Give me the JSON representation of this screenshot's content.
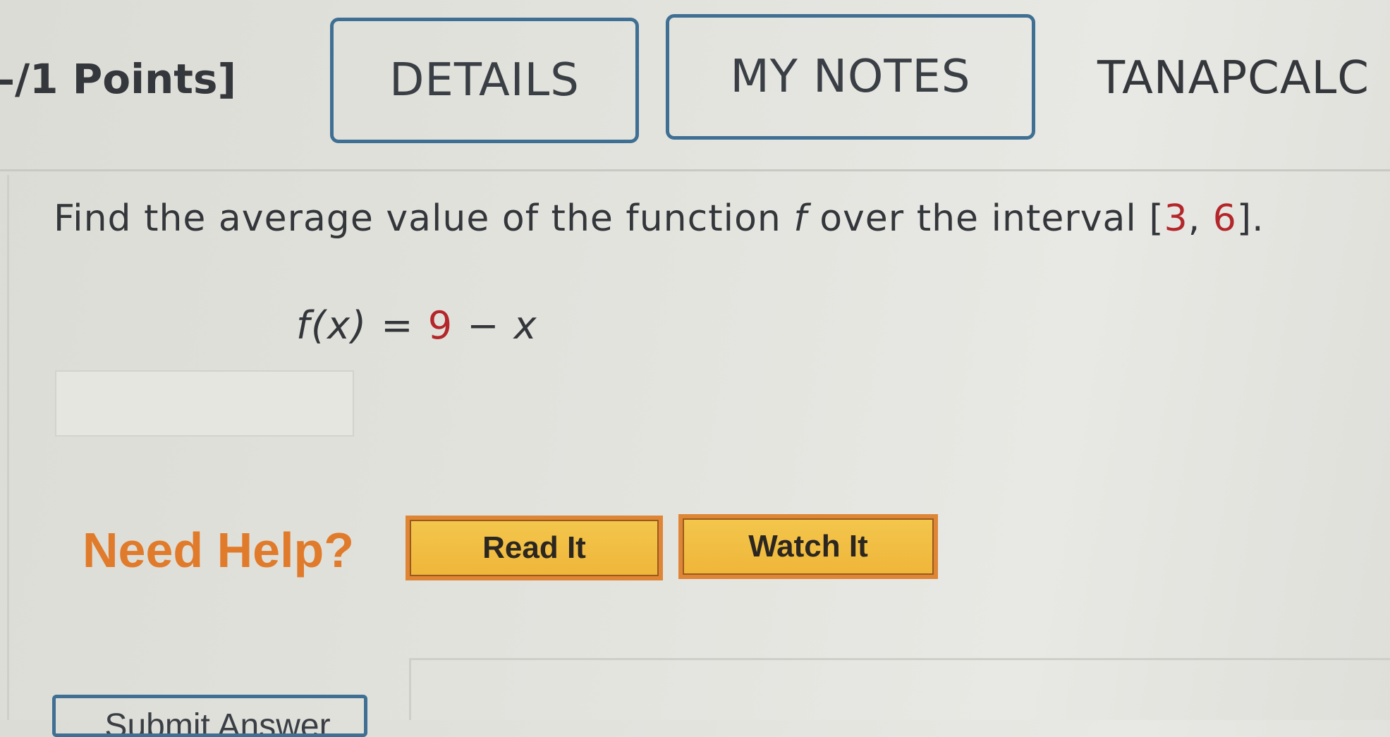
{
  "header": {
    "points_label": "–/1 Points]",
    "details_label": "DETAILS",
    "my_notes_label": "MY NOTES",
    "course_code": "TANAPCALC"
  },
  "question": {
    "prompt_before": "Find the average value of the function ",
    "function_symbol": "f",
    "prompt_middle": " over the interval [",
    "interval_start": "3",
    "interval_sep": ", ",
    "interval_end": "6",
    "prompt_after": "].",
    "equation_lhs": "f(x) = ",
    "equation_const": "9",
    "equation_rest": " − ",
    "equation_var": "x",
    "answer_value": ""
  },
  "help": {
    "need_help_label": "Need Help?",
    "read_it_label": "Read It",
    "watch_it_label": "Watch It"
  },
  "footer": {
    "submit_label": "Submit Answer"
  },
  "colors": {
    "accent_blue": "#3f6f92",
    "help_orange": "#e07b2b",
    "button_yellow": "#f3c64c",
    "highlight_red": "#b3262a"
  }
}
